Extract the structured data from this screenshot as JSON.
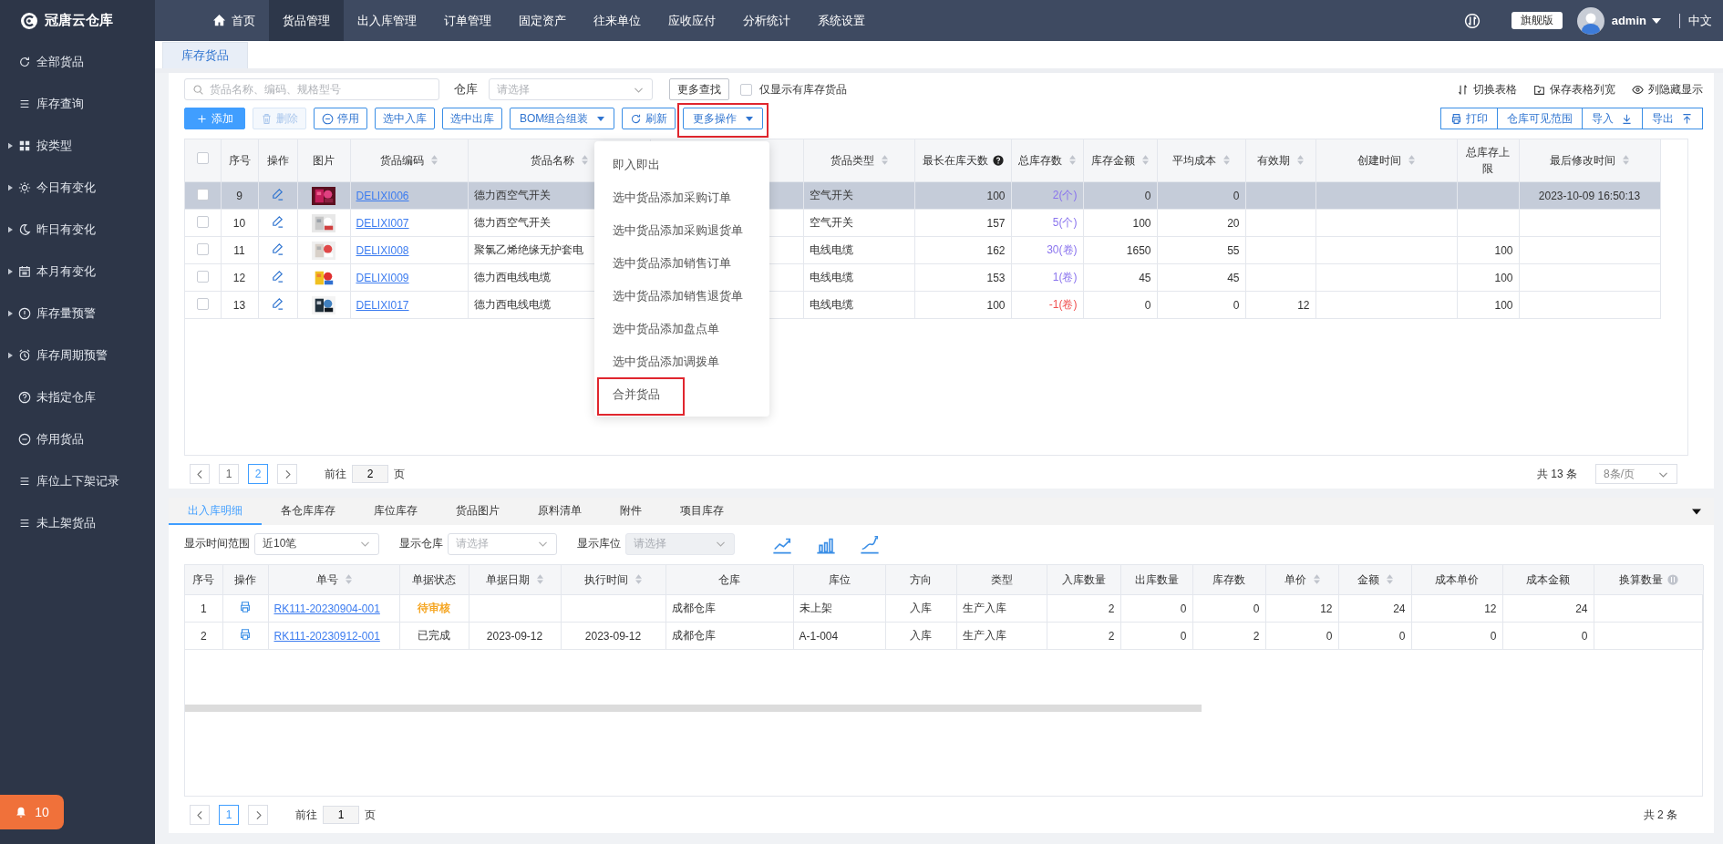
{
  "brand": {
    "name": "冠唐云仓库"
  },
  "nav": [
    {
      "label": "首页",
      "selected": false
    },
    {
      "label": "货品管理",
      "selected": true
    },
    {
      "label": "出入库管理",
      "selected": false
    },
    {
      "label": "订单管理",
      "selected": false
    },
    {
      "label": "固定资产",
      "selected": false
    },
    {
      "label": "往来单位",
      "selected": false
    },
    {
      "label": "应收应付",
      "selected": false
    },
    {
      "label": "分析统计",
      "selected": false
    },
    {
      "label": "系统设置",
      "selected": false
    }
  ],
  "header": {
    "edition": "旗舰版",
    "user": "admin",
    "language": "中文"
  },
  "sidebar": {
    "items": [
      {
        "label": "全部货品",
        "expandable": false
      },
      {
        "label": "库存查询",
        "expandable": false
      },
      {
        "label": "按类型",
        "expandable": true
      },
      {
        "label": "今日有变化",
        "expandable": true
      },
      {
        "label": "昨日有变化",
        "expandable": true
      },
      {
        "label": "本月有变化",
        "expandable": true
      },
      {
        "label": "库存量预警",
        "expandable": true
      },
      {
        "label": "库存周期预警",
        "expandable": true
      },
      {
        "label": "未指定仓库",
        "expandable": false
      },
      {
        "label": "停用货品",
        "expandable": false
      },
      {
        "label": "库位上下架记录",
        "expandable": false
      },
      {
        "label": "未上架货品",
        "expandable": false
      }
    ]
  },
  "alarm": {
    "count": "10"
  },
  "page_tabs": [
    {
      "label": "库存货品",
      "selected": true
    }
  ],
  "search": {
    "placeholder": "货品名称、编码、规格型号",
    "warehouse_label": "仓库",
    "warehouse_placeholder": "请选择",
    "more_search": "更多查找",
    "stock_only": {
      "label": "仅显示有库存货品",
      "checked": false
    }
  },
  "view_links": [
    "切换表格",
    "保存表格列宽",
    "列隐藏显示"
  ],
  "actions": [
    {
      "label": "添加",
      "kind": "primary",
      "disabled": false,
      "highlighted": false
    },
    {
      "label": "删除",
      "kind": "default",
      "disabled": true,
      "highlighted": false
    },
    {
      "label": "停用",
      "kind": "default",
      "disabled": false,
      "highlighted": false
    },
    {
      "label": "选中入库",
      "kind": "default",
      "disabled": false,
      "highlighted": false
    },
    {
      "label": "选中出库",
      "kind": "default",
      "disabled": false,
      "highlighted": false
    },
    {
      "label": "BOM组合组装",
      "kind": "dropdown",
      "disabled": false,
      "highlighted": false
    },
    {
      "label": "刷新",
      "kind": "default",
      "disabled": false,
      "highlighted": false
    },
    {
      "label": "更多操作",
      "kind": "dropdown",
      "disabled": false,
      "highlighted": true
    }
  ],
  "right_actions": [
    "打印",
    "仓库可见范围",
    "导入",
    "导出"
  ],
  "more_menu": {
    "items": [
      {
        "label": "即入即出",
        "highlighted": false
      },
      {
        "label": "选中货品添加采购订单",
        "highlighted": false
      },
      {
        "label": "选中货品添加采购退货单",
        "highlighted": false
      },
      {
        "label": "选中货品添加销售订单",
        "highlighted": false
      },
      {
        "label": "选中货品添加销售退货单",
        "highlighted": false
      },
      {
        "label": "选中货品添加盘点单",
        "highlighted": false
      },
      {
        "label": "选中货品添加调拨单",
        "highlighted": false
      },
      {
        "label": "合并货品",
        "highlighted": true
      }
    ]
  },
  "table": {
    "select_all": {
      "checked": false
    },
    "columns": [
      {
        "label": "序号",
        "sortable": false
      },
      {
        "label": "操作",
        "sortable": false
      },
      {
        "label": "图片",
        "sortable": false
      },
      {
        "label": "货品编码",
        "sortable": true
      },
      {
        "label": "货品名称",
        "sortable": true
      },
      {
        "label": "货品类型",
        "sortable": true
      },
      {
        "label": "最长在库天数",
        "sortable": false,
        "help": true
      },
      {
        "label": "总库存数",
        "sortable": true
      },
      {
        "label": "库存金额",
        "sortable": true
      },
      {
        "label": "平均成本",
        "sortable": true
      },
      {
        "label": "有效期",
        "sortable": true
      },
      {
        "label": "创建时间",
        "sortable": true
      },
      {
        "label": "总库存上限",
        "sortable": false
      },
      {
        "label": "最后修改时间",
        "sortable": true
      }
    ],
    "rows": [
      {
        "selected": true,
        "checked": false,
        "no": "9",
        "code": "DELIXI006",
        "name": "德力西空气开关",
        "type": "空气开关",
        "max_days": "100",
        "qty": "2(个)",
        "negative": false,
        "amount": "0",
        "avg_cost": "0",
        "modified": "2023-10-09 16:50:13"
      },
      {
        "selected": false,
        "checked": false,
        "no": "10",
        "code": "DELIXI007",
        "name": "德力西空气开关",
        "type": "空气开关",
        "max_days": "157",
        "qty": "5(个)",
        "negative": false,
        "amount": "100",
        "avg_cost": "20"
      },
      {
        "selected": false,
        "checked": false,
        "no": "11",
        "code": "DELIXI008",
        "name": "聚氯乙烯绝缘无护套电",
        "type": "电线电缆",
        "max_days": "162",
        "qty": "30(卷)",
        "negative": false,
        "amount": "1650",
        "avg_cost": "55",
        "limit": "100"
      },
      {
        "selected": false,
        "checked": false,
        "no": "12",
        "code": "DELIXI009",
        "name": "德力西电线电缆",
        "type": "电线电缆",
        "max_days": "153",
        "qty": "1(卷)",
        "negative": false,
        "amount": "45",
        "avg_cost": "45",
        "limit": "100"
      },
      {
        "selected": false,
        "checked": false,
        "no": "13",
        "code": "DELIXI017",
        "name": "德力西电线电缆",
        "type": "电线电缆",
        "max_days": "100",
        "qty": "-1(卷)",
        "negative": true,
        "amount": "0",
        "avg_cost": "0",
        "expiry": "12",
        "limit": "100"
      }
    ]
  },
  "pagination": {
    "pages": [
      {
        "label": "1",
        "selected": false
      },
      {
        "label": "2",
        "selected": true
      }
    ],
    "goto_label": "前往",
    "goto_value": "2",
    "page_suffix": "页",
    "total": "共 13 条",
    "page_size": "8条/页"
  },
  "detail": {
    "tabs": [
      {
        "label": "出入库明细",
        "selected": true
      },
      {
        "label": "各仓库库存",
        "selected": false
      },
      {
        "label": "库位库存",
        "selected": false
      },
      {
        "label": "货品图片",
        "selected": false
      },
      {
        "label": "原料清单",
        "selected": false
      },
      {
        "label": "附件",
        "selected": false
      },
      {
        "label": "项目库存",
        "selected": false
      }
    ],
    "filters": {
      "range_label": "显示时间范围",
      "range_value": "近10笔",
      "warehouse_label": "显示仓库",
      "warehouse_placeholder": "请选择",
      "location_label": "显示库位",
      "location_placeholder": "请选择",
      "location_disabled": true
    },
    "table": {
      "columns": [
        {
          "label": "序号",
          "sortable": false
        },
        {
          "label": "操作",
          "sortable": false
        },
        {
          "label": "单号",
          "sortable": true
        },
        {
          "label": "单据状态",
          "sortable": false
        },
        {
          "label": "单据日期",
          "sortable": true
        },
        {
          "label": "执行时间",
          "sortable": true
        },
        {
          "label": "仓库",
          "sortable": false
        },
        {
          "label": "库位",
          "sortable": false
        },
        {
          "label": "方向",
          "sortable": false
        },
        {
          "label": "类型",
          "sortable": false
        },
        {
          "label": "入库数量",
          "sortable": false
        },
        {
          "label": "出库数量",
          "sortable": false
        },
        {
          "label": "库存数",
          "sortable": false
        },
        {
          "label": "单价",
          "sortable": true
        },
        {
          "label": "金额",
          "sortable": true
        },
        {
          "label": "成本单价",
          "sortable": false
        },
        {
          "label": "成本金额",
          "sortable": false
        },
        {
          "label": "换算数量",
          "sortable": false,
          "info": true
        }
      ],
      "rows": [
        {
          "no": "1",
          "doc_no": "RK111-20230904-001",
          "status": "待审核",
          "kind": "pending",
          "warehouse": "成都仓库",
          "location": "未上架",
          "direction": "入库",
          "type": "生产入库",
          "in_qty": "2",
          "out_qty": "0",
          "stock": "0",
          "price": "12",
          "amount": "24",
          "cost_price": "12",
          "cost_amount": "24"
        },
        {
          "no": "2",
          "doc_no": "RK111-20230912-001",
          "status": "已完成",
          "kind": "done",
          "doc_date": "2023-09-12",
          "exec_time": "2023-09-12",
          "warehouse": "成都仓库",
          "location": "A-1-004",
          "direction": "入库",
          "type": "生产入库",
          "in_qty": "2",
          "out_qty": "0",
          "stock": "2",
          "price": "0",
          "amount": "0",
          "cost_price": "0",
          "cost_amount": "0"
        }
      ]
    },
    "pagination": {
      "pages": [
        {
          "label": "1",
          "selected": true
        }
      ],
      "goto_label": "前往",
      "goto_value": "1",
      "page_suffix": "页",
      "total": "共 2 条"
    }
  }
}
